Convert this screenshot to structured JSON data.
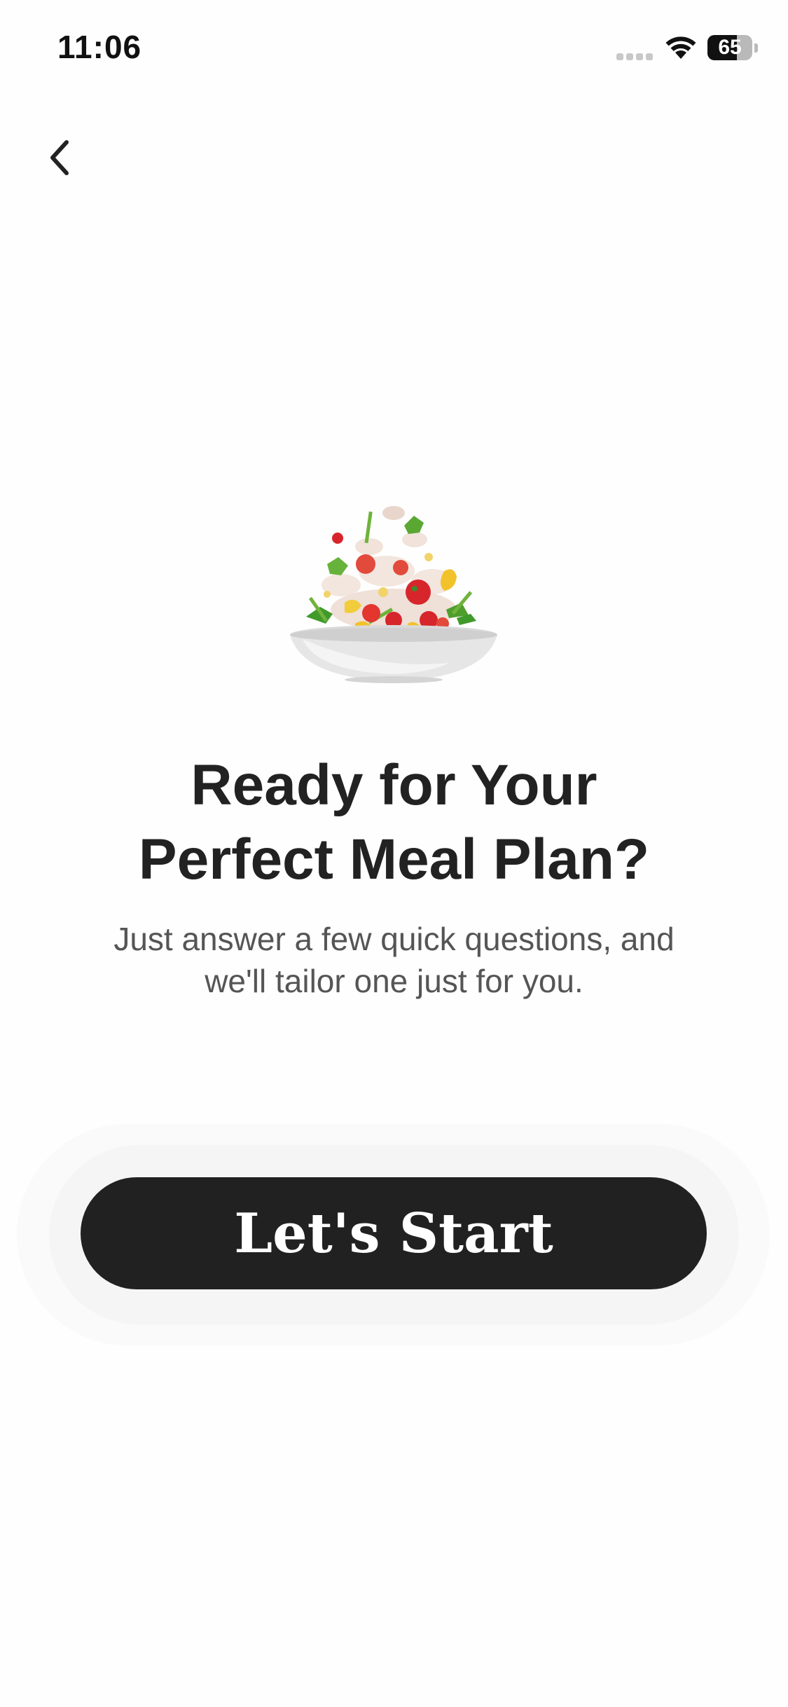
{
  "status_bar": {
    "time": "11:06",
    "battery_level": "65",
    "battery_fraction": 0.65
  },
  "nav": {
    "back_icon": "chevron-left-icon"
  },
  "illustration": {
    "icon": "salad-bowl-illustration"
  },
  "hero": {
    "title_line1": "Ready for Your",
    "title_line2": "Perfect Meal Plan?",
    "subtitle_line1": "Just answer a few quick questions, and",
    "subtitle_line2": "we'll tailor one just for you."
  },
  "cta": {
    "label": "Let's Start"
  },
  "colors": {
    "background": "#fefefe",
    "text_primary": "#222222",
    "text_secondary": "#555555",
    "button_bg": "#212121",
    "button_text": "#ffffff"
  }
}
